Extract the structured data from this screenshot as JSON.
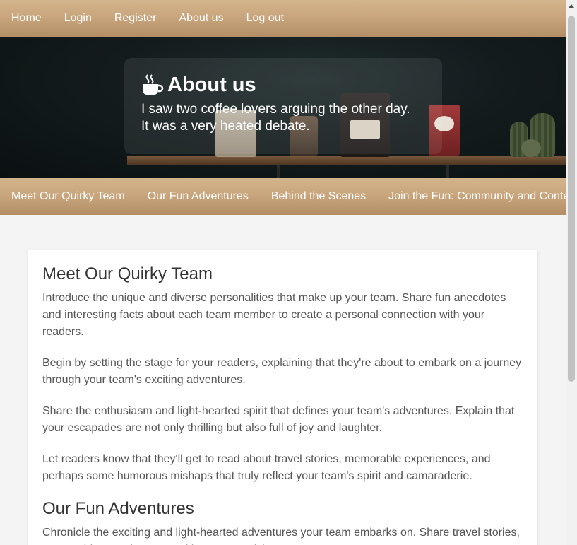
{
  "topnav": {
    "items": [
      "Home",
      "Login",
      "Register",
      "About us",
      "Log out"
    ]
  },
  "hero": {
    "icon": "coffee-cup-icon",
    "title": "About us",
    "subtitle_line1": "I saw two coffee lovers arguing the other day.",
    "subtitle_line2": "It was a very heated debate."
  },
  "sectionnav": {
    "items": [
      "Meet Our Quirky Team",
      "Our Fun Adventures",
      "Behind the Scenes",
      "Join the Fun: Community and Contests"
    ]
  },
  "content": {
    "section1_heading": "Meet Our Quirky Team",
    "section1_paragraphs": [
      "Introduce the unique and diverse personalities that make up your team. Share fun anecdotes and interesting facts about each team member to create a personal connection with your readers.",
      "Begin by setting the stage for your readers, explaining that they're about to embark on a journey through your team's exciting adventures.",
      "Share the enthusiasm and light-hearted spirit that defines your team's adventures. Explain that your escapades are not only thrilling but also full of joy and laughter.",
      "Let readers know that they'll get to read about travel stories, memorable experiences, and perhaps some humorous mishaps that truly reflect your team's spirit and camaraderie."
    ],
    "section2_heading": "Our Fun Adventures",
    "section2_paragraph": "Chronicle the exciting and light-hearted adventures your team embarks on. Share travel stories, memorable experiences, and humorous mishaps."
  },
  "colors": {
    "nav_gradient_top": "#d4b48c",
    "nav_gradient_bottom": "#b38e66",
    "page_background": "#f4f4f4"
  }
}
